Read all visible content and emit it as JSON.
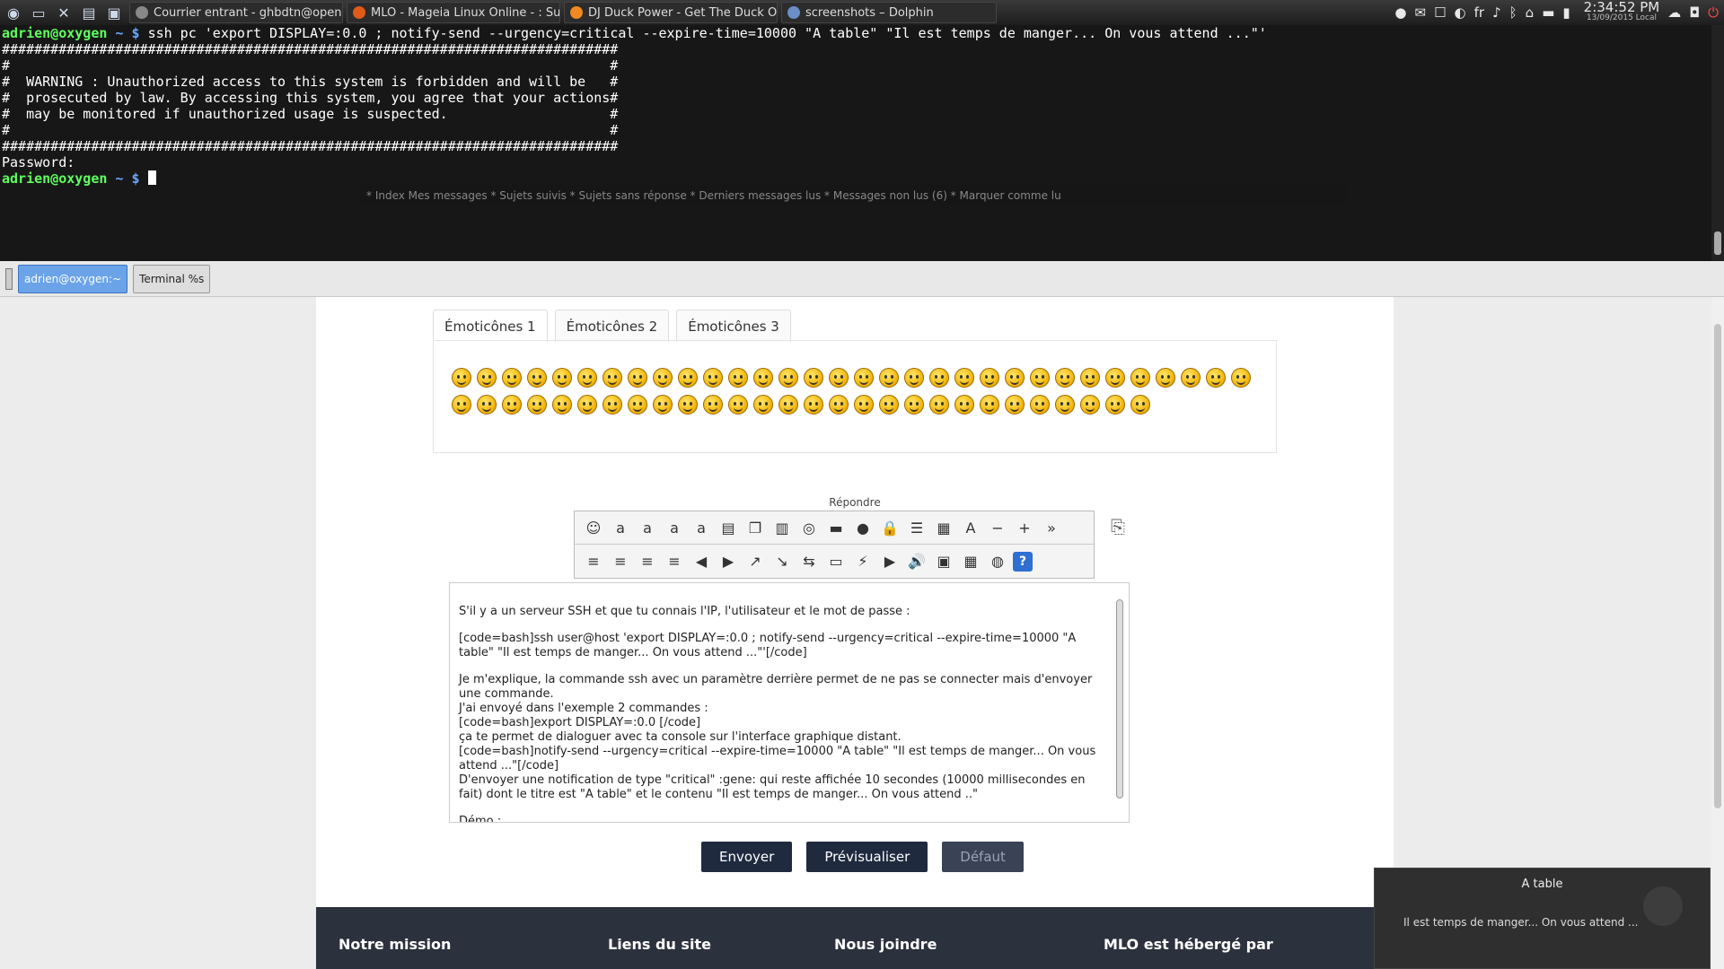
{
  "taskbar": {
    "tasks": [
      {
        "label": "Courrier entrant - ghbdtn@openma",
        "color": "#888888"
      },
      {
        "label": "MLO - Mageia Linux Online - : Sujet -",
        "color": "#e05a1a"
      },
      {
        "label": "DJ Duck Power - Get The Duck Out O",
        "color": "#f08a20"
      },
      {
        "label": "screenshots – Dolphin",
        "color": "#6a8fc4"
      }
    ],
    "lang": "fr",
    "clock_time": "2:34:52 PM",
    "clock_date": "13/09/2015 Local"
  },
  "terminal": {
    "prompt_user": "adrien@oxygen",
    "prompt_path": " ~ $ ",
    "command": "ssh pc 'export DISPLAY=:0.0 ; notify-send --urgency=critical --expire-time=10000 \"A table\" \"Il est temps de manger... On vous attend ...\"'",
    "banner": "############################################################################\n#                                                                          #\n#  WARNING : Unauthorized access to this system is forbidden and will be   #\n#  prosecuted by law. By accessing this system, you agree that your actions#\n#  may be monitored if unauthorized usage is suspected.                    #\n#                                                                          #\n############################################################################",
    "password_line": "Password:",
    "ghost_text": "* Index                                    Mes messages * Sujets suivis * Sujets sans réponse * Derniers messages lus * Messages non lus (6) * Marquer comme lu"
  },
  "terminal_tabs": [
    {
      "label": "adrien@oxygen:~",
      "active": true
    },
    {
      "label": "Terminal %s",
      "active": false
    }
  ],
  "smiley_tabs": [
    "Émoticônes 1",
    "Émoticônes 2",
    "Émoticônes 3"
  ],
  "smiley_count": 60,
  "reply_label": "Répondre",
  "toolbar_row1": [
    "☺",
    "a",
    "a",
    "a",
    "a",
    "▤",
    "❐",
    "▥",
    "◎",
    "▬",
    "●",
    "🔒",
    "☰",
    "▦",
    "A",
    "−",
    "+",
    "»"
  ],
  "toolbar_row2": [
    "≡",
    "≡",
    "≡",
    "≡",
    "◀",
    "▶",
    "↗",
    "↘",
    "⇆",
    "▭",
    "⚡",
    "▶",
    "🔊",
    "▣",
    "▦",
    "◍",
    "?"
  ],
  "editor": {
    "paragraphs": [
      "S'il y a un serveur SSH et que tu connais l'IP, l'utilisateur et le mot de passe :",
      "[code=bash]ssh user@host 'export DISPLAY=:0.0 ; notify-send --urgency=critical --expire-time=10000 \"A table\" \"Il est temps de manger... On vous attend ...\"'[/code]",
      "Je m'explique, la commande ssh avec un paramètre derrière permet de ne pas se connecter mais d'envoyer une commande.\nJ'ai envoyé dans l'exemple 2 commandes :\n[code=bash]export DISPLAY=:0.0 [/code]\nça te permet de dialoguer avec ta console sur l'interface graphique distant.\n[code=bash]notify-send --urgency=critical --expire-time=10000 \"A table\" \"Il est temps de manger... On vous attend ...\"[/code]\nD'envoyer une notification de type \"critical\" :gene: qui reste affichée 10 secondes (10000 millisecondes en fait) dont le titre est \"A table\" et le contenu \"Il est temps de manger... On vous attend ..\"",
      "Démo :"
    ]
  },
  "buttons": {
    "send": "Envoyer",
    "preview": "Prévisualiser",
    "default": "Défaut"
  },
  "footer": [
    "Notre mission",
    "Liens du site",
    "Nous joindre",
    "MLO est hébergé par"
  ],
  "notification": {
    "title": "A table",
    "body": "Il est temps de manger... On vous attend ..."
  }
}
